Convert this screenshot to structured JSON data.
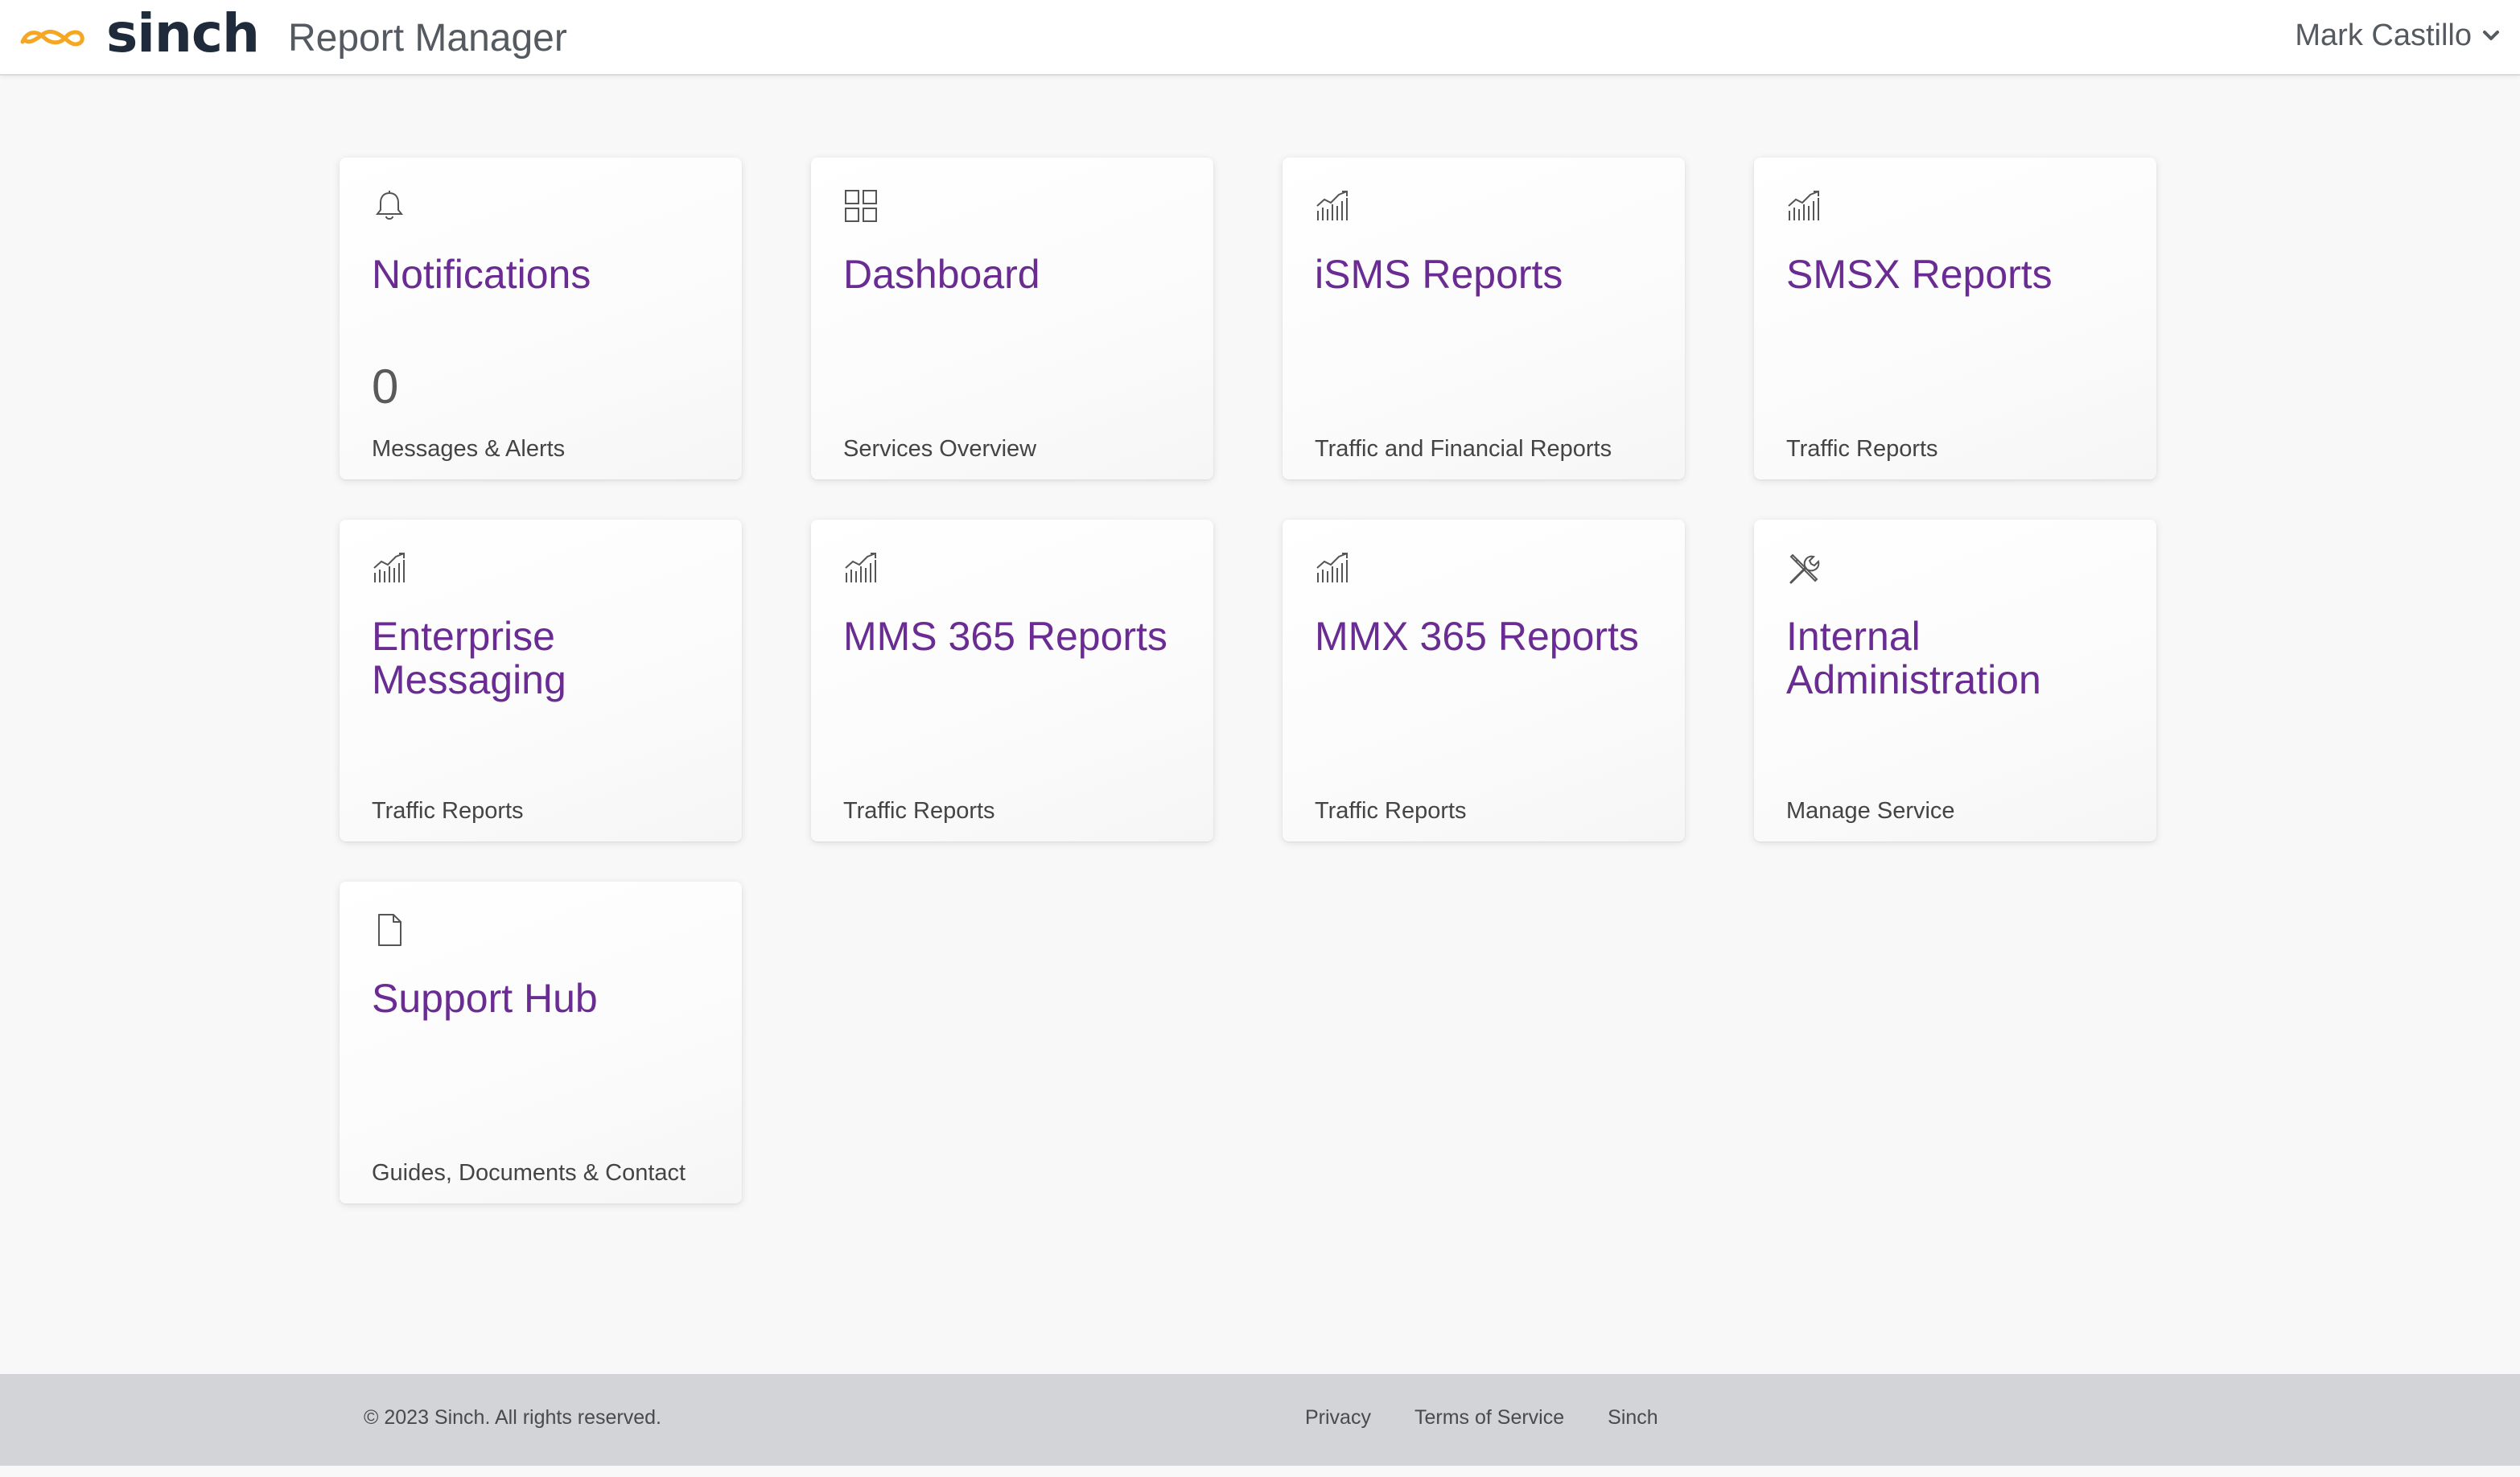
{
  "header": {
    "logo_text": "sinch",
    "app_title": "Report Manager",
    "user_name": "Mark Castillo",
    "brand_color": "#f5a623"
  },
  "cards": [
    {
      "icon": "bell-icon",
      "title": "Notifications",
      "count": "0",
      "subtitle": "Messages & Alerts"
    },
    {
      "icon": "grid-icon",
      "title": "Dashboard",
      "subtitle": "Services Overview"
    },
    {
      "icon": "chart-icon",
      "title": "iSMS Reports",
      "subtitle": "Traffic and Financial Reports"
    },
    {
      "icon": "chart-icon",
      "title": "SMSX Reports",
      "subtitle": "Traffic Reports"
    },
    {
      "icon": "chart-icon",
      "title": "Enterprise Messaging",
      "subtitle": "Traffic Reports"
    },
    {
      "icon": "chart-icon",
      "title": "MMS 365 Reports",
      "subtitle": "Traffic Reports"
    },
    {
      "icon": "chart-icon",
      "title": "MMX 365 Reports",
      "subtitle": "Traffic Reports"
    },
    {
      "icon": "tools-icon",
      "title": "Internal Administration",
      "subtitle": "Manage Service"
    },
    {
      "icon": "document-icon",
      "title": "Support Hub",
      "subtitle": "Guides, Documents & Contact"
    }
  ],
  "footer": {
    "copyright": "© 2023 Sinch. All rights reserved.",
    "links": [
      "Privacy",
      "Terms of Service",
      "Sinch"
    ]
  },
  "colors": {
    "title_purple": "#6a2b93",
    "footer_bg": "#d3d4d8"
  }
}
